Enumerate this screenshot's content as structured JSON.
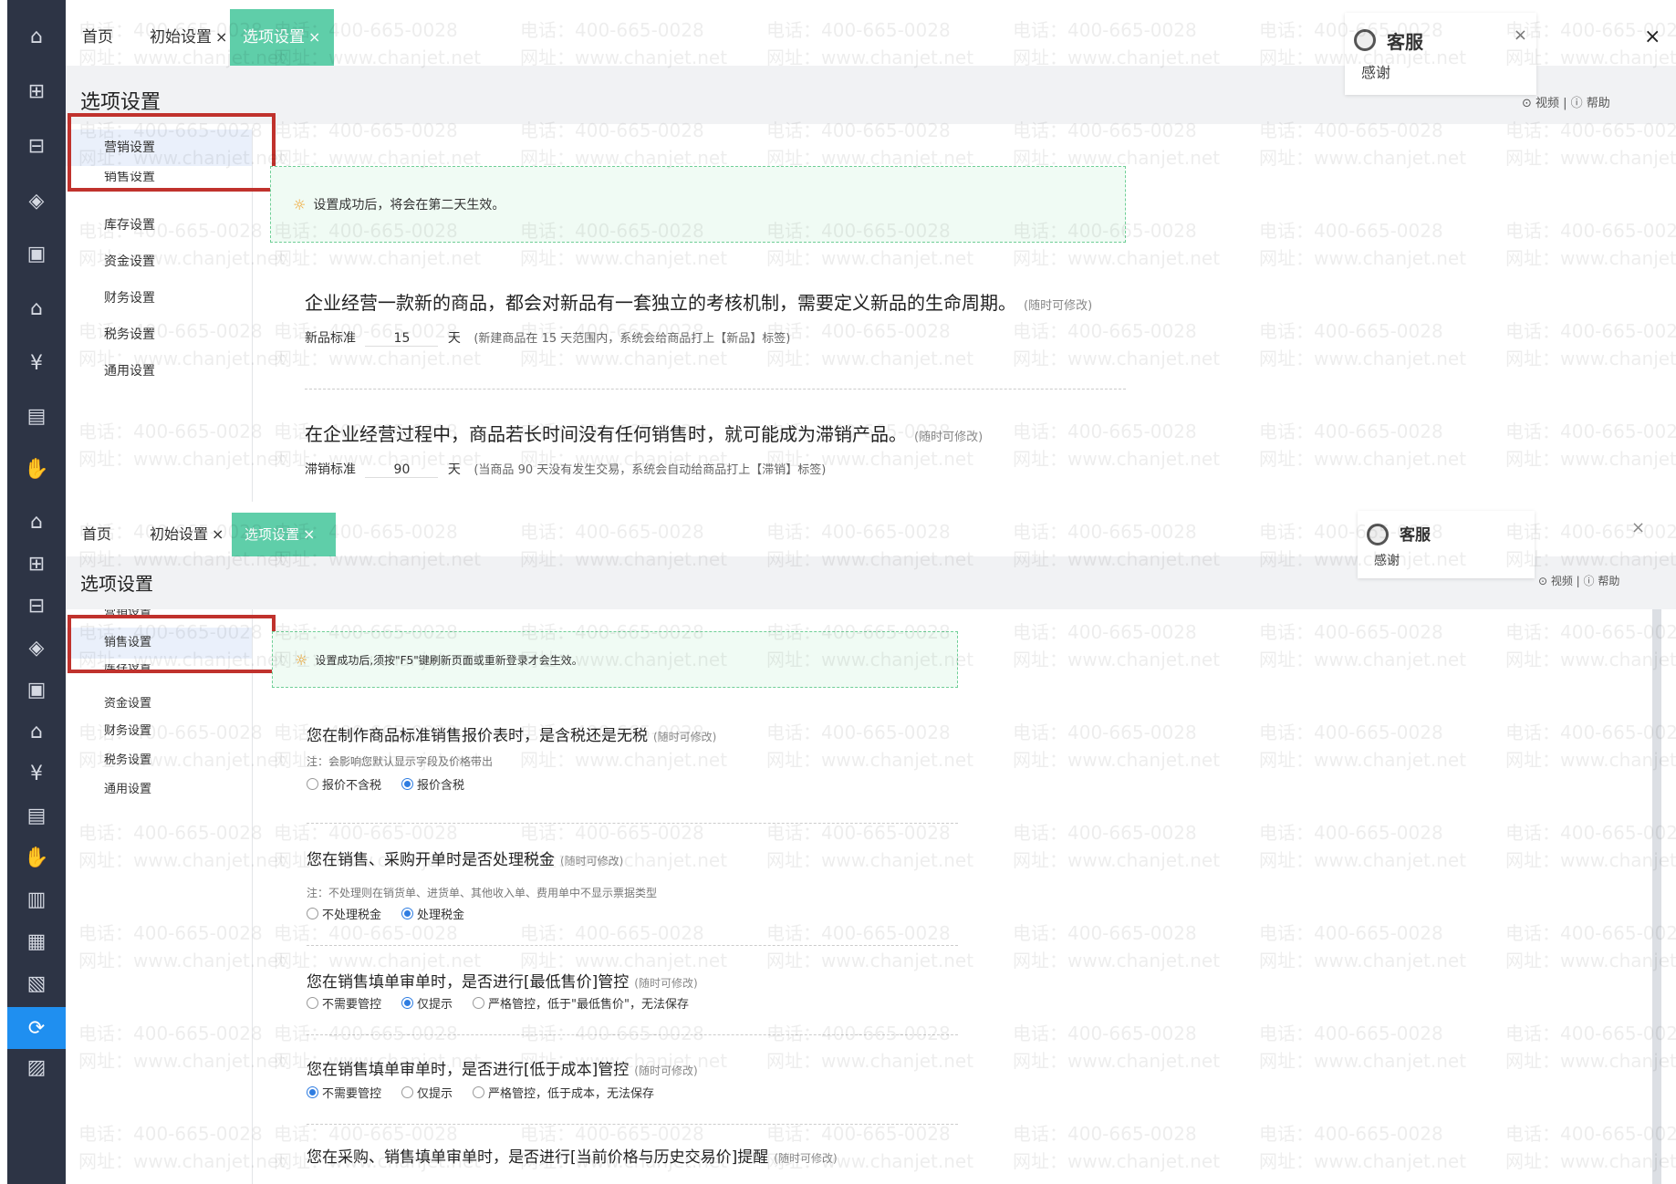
{
  "top": {
    "tabs": [
      {
        "label": "首页"
      },
      {
        "label": "初始设置"
      },
      {
        "label": "选项设置"
      }
    ],
    "page_title": "选项设置",
    "tools": "⊙ 视频 | ⓘ 帮助",
    "customer_service": {
      "name": "客服",
      "thanks": "感谢"
    },
    "menu": [
      "营销设置",
      "销售设置",
      "库存设置",
      "资金设置",
      "财务设置",
      "税务设置",
      "通用设置"
    ],
    "notice": "设置成功后，将会在第二天生效。",
    "section1": {
      "heading": "企业经营一款新的商品，都会对新品有一套独立的考核机制，需要定义新品的生命周期。",
      "hint": "(随时可修改)",
      "label": "新品标准",
      "value": "15",
      "unit": "天",
      "desc": "(新建商品在 15 天范围内，系统会给商品打上【新品】标签)"
    },
    "section2": {
      "heading": "在企业经营过程中，商品若长时间没有任何销售时，就可能成为滞销产品。",
      "hint": "(随时可修改)",
      "label": "滞销标准",
      "value": "90",
      "unit": "天",
      "desc": "(当商品 90 天没有发生交易，系统会自动给商品打上【滞销】标签)"
    }
  },
  "bottom": {
    "tabs": [
      {
        "label": "首页"
      },
      {
        "label": "初始设置"
      },
      {
        "label": "选项设置"
      }
    ],
    "page_title": "选项设置",
    "tools": "⊙ 视频 | ⓘ 帮助",
    "customer_service": {
      "name": "客服",
      "thanks": "感谢"
    },
    "menu": [
      "营销设置",
      "销售设置",
      "库存设置",
      "资金设置",
      "财务设置",
      "税务设置",
      "通用设置"
    ],
    "notice": "设置成功后,须按\"F5\"键刷新页面或重新登录才会生效。",
    "questions": [
      {
        "title": "您在制作商品标准销售报价表时，是含税还是无税",
        "hint": "(随时可修改)",
        "note": "注：会影响您默认显示字段及价格带出",
        "options": [
          "报价不含税",
          "报价含税"
        ],
        "selected": 1
      },
      {
        "title": "您在销售、采购开单时是否处理税金",
        "hint": "(随时可修改)",
        "note": "注：不处理则在销货单、进货单、其他收入单、费用单中不显示票据类型",
        "options": [
          "不处理税金",
          "处理税金"
        ],
        "selected": 1
      },
      {
        "title": "您在销售填单审单时，是否进行[最低售价]管控",
        "hint": "(随时可修改)",
        "note": "",
        "options": [
          "不需要管控",
          "仅提示",
          "严格管控，低于\"最低售价\"，无法保存"
        ],
        "selected": 1
      },
      {
        "title": "您在销售填单审单时，是否进行[低于成本]管控",
        "hint": "(随时可修改)",
        "note": "",
        "options": [
          "不需要管控",
          "仅提示",
          "严格管控，低于成本，无法保存"
        ],
        "selected": 0
      },
      {
        "title": "您在采购、销售填单审单时，是否进行[当前价格与历史交易价]提醒",
        "hint": "(随时可修改)",
        "note": "",
        "options": [],
        "selected": -1
      }
    ]
  },
  "watermark": {
    "phone": "电话：400-665-0028",
    "site": "网址：www.chanjet.net"
  },
  "colors": {
    "sidebar": "#2d3445",
    "active_tab": "#5fcea9",
    "active_nav": "#1f8ff0",
    "highlight_box": "#c0322d",
    "notice_border": "#6fcf97",
    "radio": "#2f7de1"
  }
}
